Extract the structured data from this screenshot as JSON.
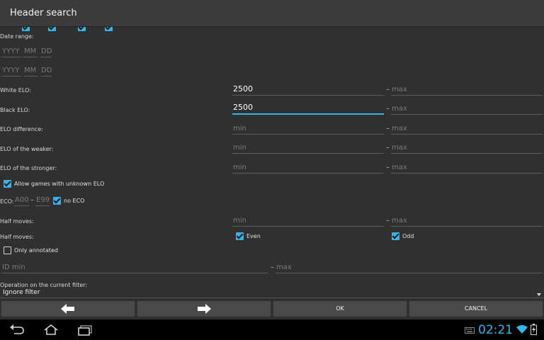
{
  "title": "Header search",
  "labels": {
    "date_range": "Date range:",
    "white_elo": "White ELO:",
    "black_elo": "Black ELO:",
    "elo_difference": "ELO difference:",
    "elo_weaker": "ELO of the weaker:",
    "elo_stronger": "ELO of the stronger:",
    "eco": "ECO:",
    "half_moves_1": "Half moves:",
    "half_moves_2": "Half moves:",
    "operation": "Operation on the current filter:"
  },
  "placeholders": {
    "year": "YYYY",
    "month": "MM",
    "day": "DD",
    "min": "min",
    "max": "max",
    "eco_from": "A00",
    "eco_to": "E99",
    "id_min": "ID min"
  },
  "values": {
    "white_elo_min": "2500",
    "black_elo_min": "2500"
  },
  "separator": "–",
  "checkboxes": {
    "allow_unknown_elo": {
      "label": "Allow games with unknown ELO",
      "checked": true
    },
    "no_eco": {
      "label": "no ECO",
      "checked": true
    },
    "even": {
      "label": "Even",
      "checked": true
    },
    "odd": {
      "label": "Odd",
      "checked": true
    },
    "only_annotated": {
      "label": "Only annotated",
      "checked": false
    }
  },
  "operation_value": "Ignore filter",
  "buttons": {
    "back_icon": "arrow-left-icon",
    "forward_icon": "arrow-right-icon",
    "ok": "OK",
    "cancel": "CANCEL"
  },
  "status": {
    "time": "02:21"
  },
  "colors": {
    "accent": "#33b5e5",
    "background": "#303030",
    "titlebar": "#3b3b3b",
    "button": "#4a4a4a"
  }
}
